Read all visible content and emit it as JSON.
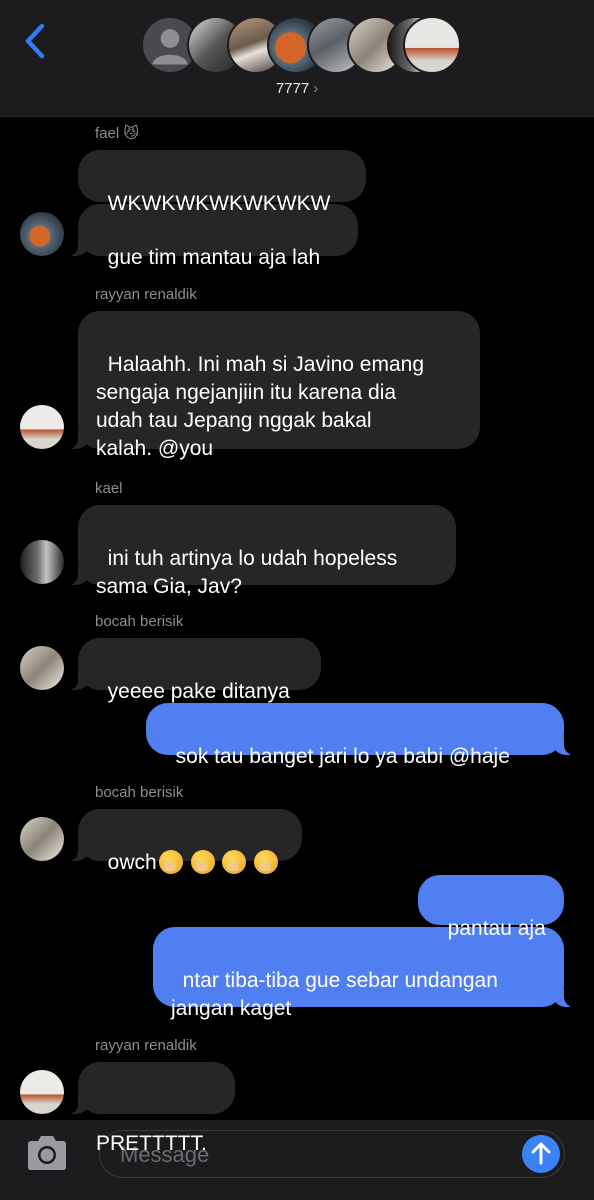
{
  "header": {
    "group_name": "7777",
    "chevron": "›",
    "back_icon": "chevron-left-icon"
  },
  "colors": {
    "incoming_bubble": "#262628",
    "outgoing_bubble": "#4f7ff0",
    "accent": "#2f7cf6"
  },
  "messages": [
    {
      "sender": "fael",
      "sender_emoji": "😼"
    },
    {
      "text": "WKWKWKWKWKWKW"
    },
    {
      "text": "gue tim mantau aja lah"
    },
    {
      "sender": "rayyan renaldik"
    },
    {
      "text": "Halaahh. Ini mah si Javino emang\nsengaja ngejanjiin itu karena dia\nudah tau Jepang nggak bakal\nkalah. @you"
    },
    {
      "sender": "kael"
    },
    {
      "text": "ini tuh artinya lo udah hopeless\nsama Gia, Jav?"
    },
    {
      "sender": "bocah berisik"
    },
    {
      "text": "yeeee pake ditanya"
    },
    {
      "text": "sok tau banget jari lo ya babi @haje"
    },
    {
      "sender": "bocah berisik"
    },
    {
      "text": "owch"
    },
    {
      "text": "pantau aja"
    },
    {
      "text": "ntar tiba-tiba gue sebar undangan\njangan kaget"
    },
    {
      "sender": "rayyan renaldik"
    },
    {
      "text": "PRETTTTT."
    }
  ],
  "composer": {
    "placeholder": "Message",
    "camera_icon": "camera-icon",
    "send_icon": "arrow-up-icon"
  }
}
